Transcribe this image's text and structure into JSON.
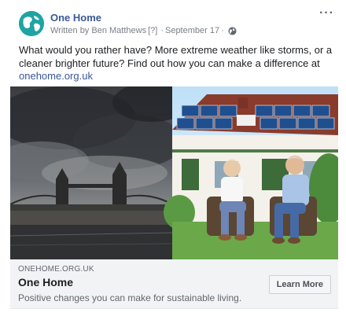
{
  "post": {
    "page_name": "One Home",
    "written_by": "Written by Ben Matthews",
    "help_marker": "[?]",
    "separator": "·",
    "date": "September 17",
    "dot": "·",
    "privacy_icon": "globe-icon",
    "more_label": "···",
    "text": "What would you rather have? More extreme weather like storms, or a cleaner brighter future? Find out how you can make a difference at",
    "link_text": "onehome.org.uk"
  },
  "media": {
    "left_image": "storm-over-tower-bridge",
    "right_image": "couple-in-front-of-solar-house"
  },
  "preview": {
    "domain": "ONEHOME.ORG.UK",
    "title": "One Home",
    "description": "Positive changes you can make for sustainable living.",
    "cta_label": "Learn More"
  },
  "colors": {
    "link": "#385898",
    "secondary_text": "#606770",
    "preview_bg": "#f2f3f5"
  }
}
